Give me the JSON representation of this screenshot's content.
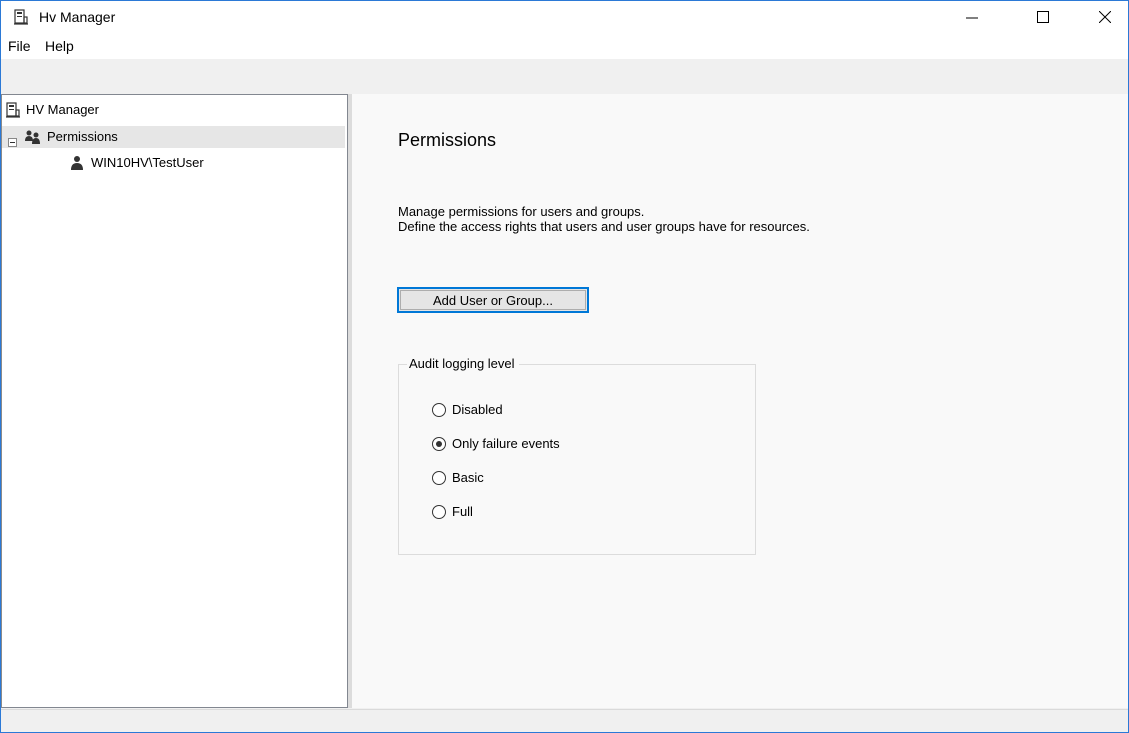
{
  "window": {
    "title": "Hv Manager",
    "controls": [
      "minimize",
      "maximize",
      "close"
    ]
  },
  "menu": {
    "items": [
      "File",
      "Help"
    ]
  },
  "tree": {
    "root": {
      "label": "HV Manager",
      "icon": "server-icon"
    },
    "permissions": {
      "label": "Permissions",
      "icon": "users-icon",
      "expander": "⊟",
      "selected": true
    },
    "user": {
      "label": "WIN10HV\\TestUser",
      "icon": "user-icon"
    }
  },
  "content": {
    "title": "Permissions",
    "description_line1": "Manage permissions for users and groups.",
    "description_line2": "Define the access rights that users and user groups have for resources.",
    "add_button_label": "Add User or Group...",
    "audit": {
      "legend": "Audit logging level",
      "options": [
        {
          "label": "Disabled",
          "checked": false
        },
        {
          "label": "Only failure events",
          "checked": true
        },
        {
          "label": "Basic",
          "checked": false
        },
        {
          "label": "Full",
          "checked": false
        }
      ]
    }
  },
  "colors": {
    "window_border": "#2b79d6",
    "button_focus_border": "#0078d7",
    "selection": "#e6e6e6"
  }
}
